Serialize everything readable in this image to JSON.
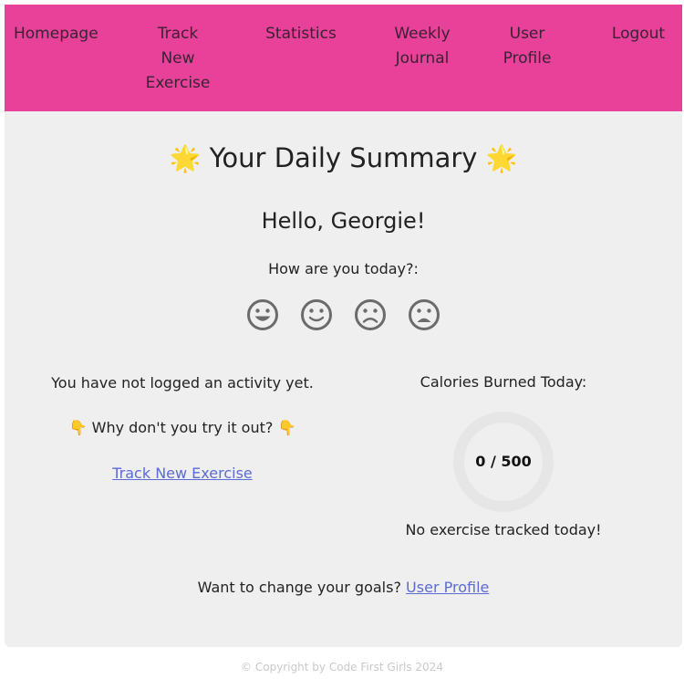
{
  "nav": {
    "homepage": "Homepage",
    "track_new_exercise": "Track New Exercise",
    "statistics": "Statistics",
    "weekly_journal": "Weekly Journal",
    "user_profile": "User Profile",
    "logout": "Logout"
  },
  "summary": {
    "title": "Your Daily Summary",
    "title_emoji": "🌟",
    "greeting": "Hello, Georgie!",
    "mood_question": "How are you today?:",
    "moods": [
      "very-happy-face-icon",
      "smile-face-icon",
      "frown-face-icon",
      "sad-face-icon"
    ]
  },
  "activity": {
    "not_logged": "You have not logged an activity yet.",
    "prompt": "Why don't you try it out?",
    "prompt_emoji": "👇",
    "link_label": "Track New Exercise"
  },
  "calories": {
    "label": "Calories Burned Today:",
    "current": 0,
    "goal": 500,
    "display": "0 / 500",
    "empty_message": "No exercise tracked today!"
  },
  "goals": {
    "text": "Want to change your goals?",
    "link_label": "User Profile"
  },
  "footer": {
    "copyright": "© Copyright by Code First Girls 2024"
  },
  "colors": {
    "nav_background": "#e8419a",
    "panel_background": "#efefef",
    "link": "#5b6bd1",
    "ring_track": "#e6e6e6"
  }
}
